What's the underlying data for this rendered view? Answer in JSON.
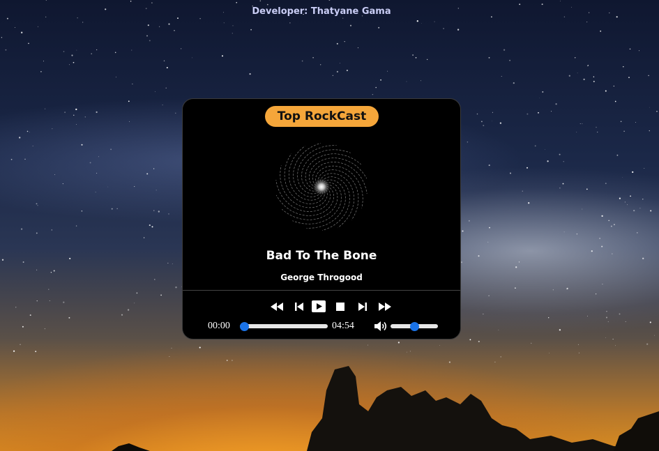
{
  "header": {
    "credit": "Developer: Thatyane Gama"
  },
  "player": {
    "badge": "Top RockCast",
    "song_title": "Bad To The Bone",
    "artist": "George Throgood",
    "current_time": "00:00",
    "duration": "04:54",
    "progress_fraction": 0.0,
    "volume_fraction": 0.5
  },
  "icons": {
    "rewind": "rewind-icon",
    "previous": "skip-previous-icon",
    "play": "play-icon",
    "stop": "stop-icon",
    "next": "skip-next-icon",
    "fast_forward": "fast-forward-icon",
    "volume": "volume-icon"
  },
  "colors": {
    "badge_bg": "#f5a63a",
    "slider_thumb": "#1a73e8",
    "credit_text": "#c9cdf5",
    "panel_bg": "#000000"
  }
}
